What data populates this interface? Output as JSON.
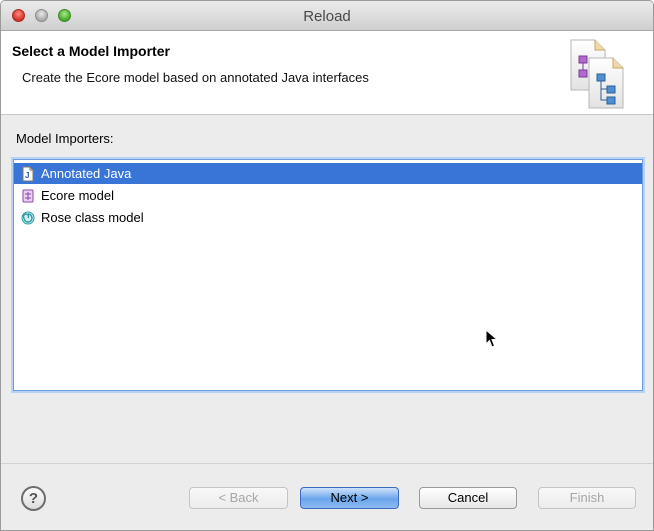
{
  "window": {
    "title": "Reload"
  },
  "header": {
    "title": "Select a Model Importer",
    "description": "Create the Ecore model based on annotated Java interfaces"
  },
  "importers": {
    "label": "Model Importers:",
    "items": [
      {
        "label": "Annotated Java",
        "icon": "java-file-icon",
        "selected": true
      },
      {
        "label": "Ecore model",
        "icon": "ecore-icon",
        "selected": false
      },
      {
        "label": "Rose class model",
        "icon": "rose-icon",
        "selected": false
      }
    ]
  },
  "buttons": {
    "back": "< Back",
    "next": "Next >",
    "cancel": "Cancel",
    "finish": "Finish",
    "help": "?"
  },
  "colors": {
    "selection": "#3875d7",
    "default_button": "#6aa5ec",
    "close": "#d2302a",
    "maximize": "#46a82b"
  }
}
